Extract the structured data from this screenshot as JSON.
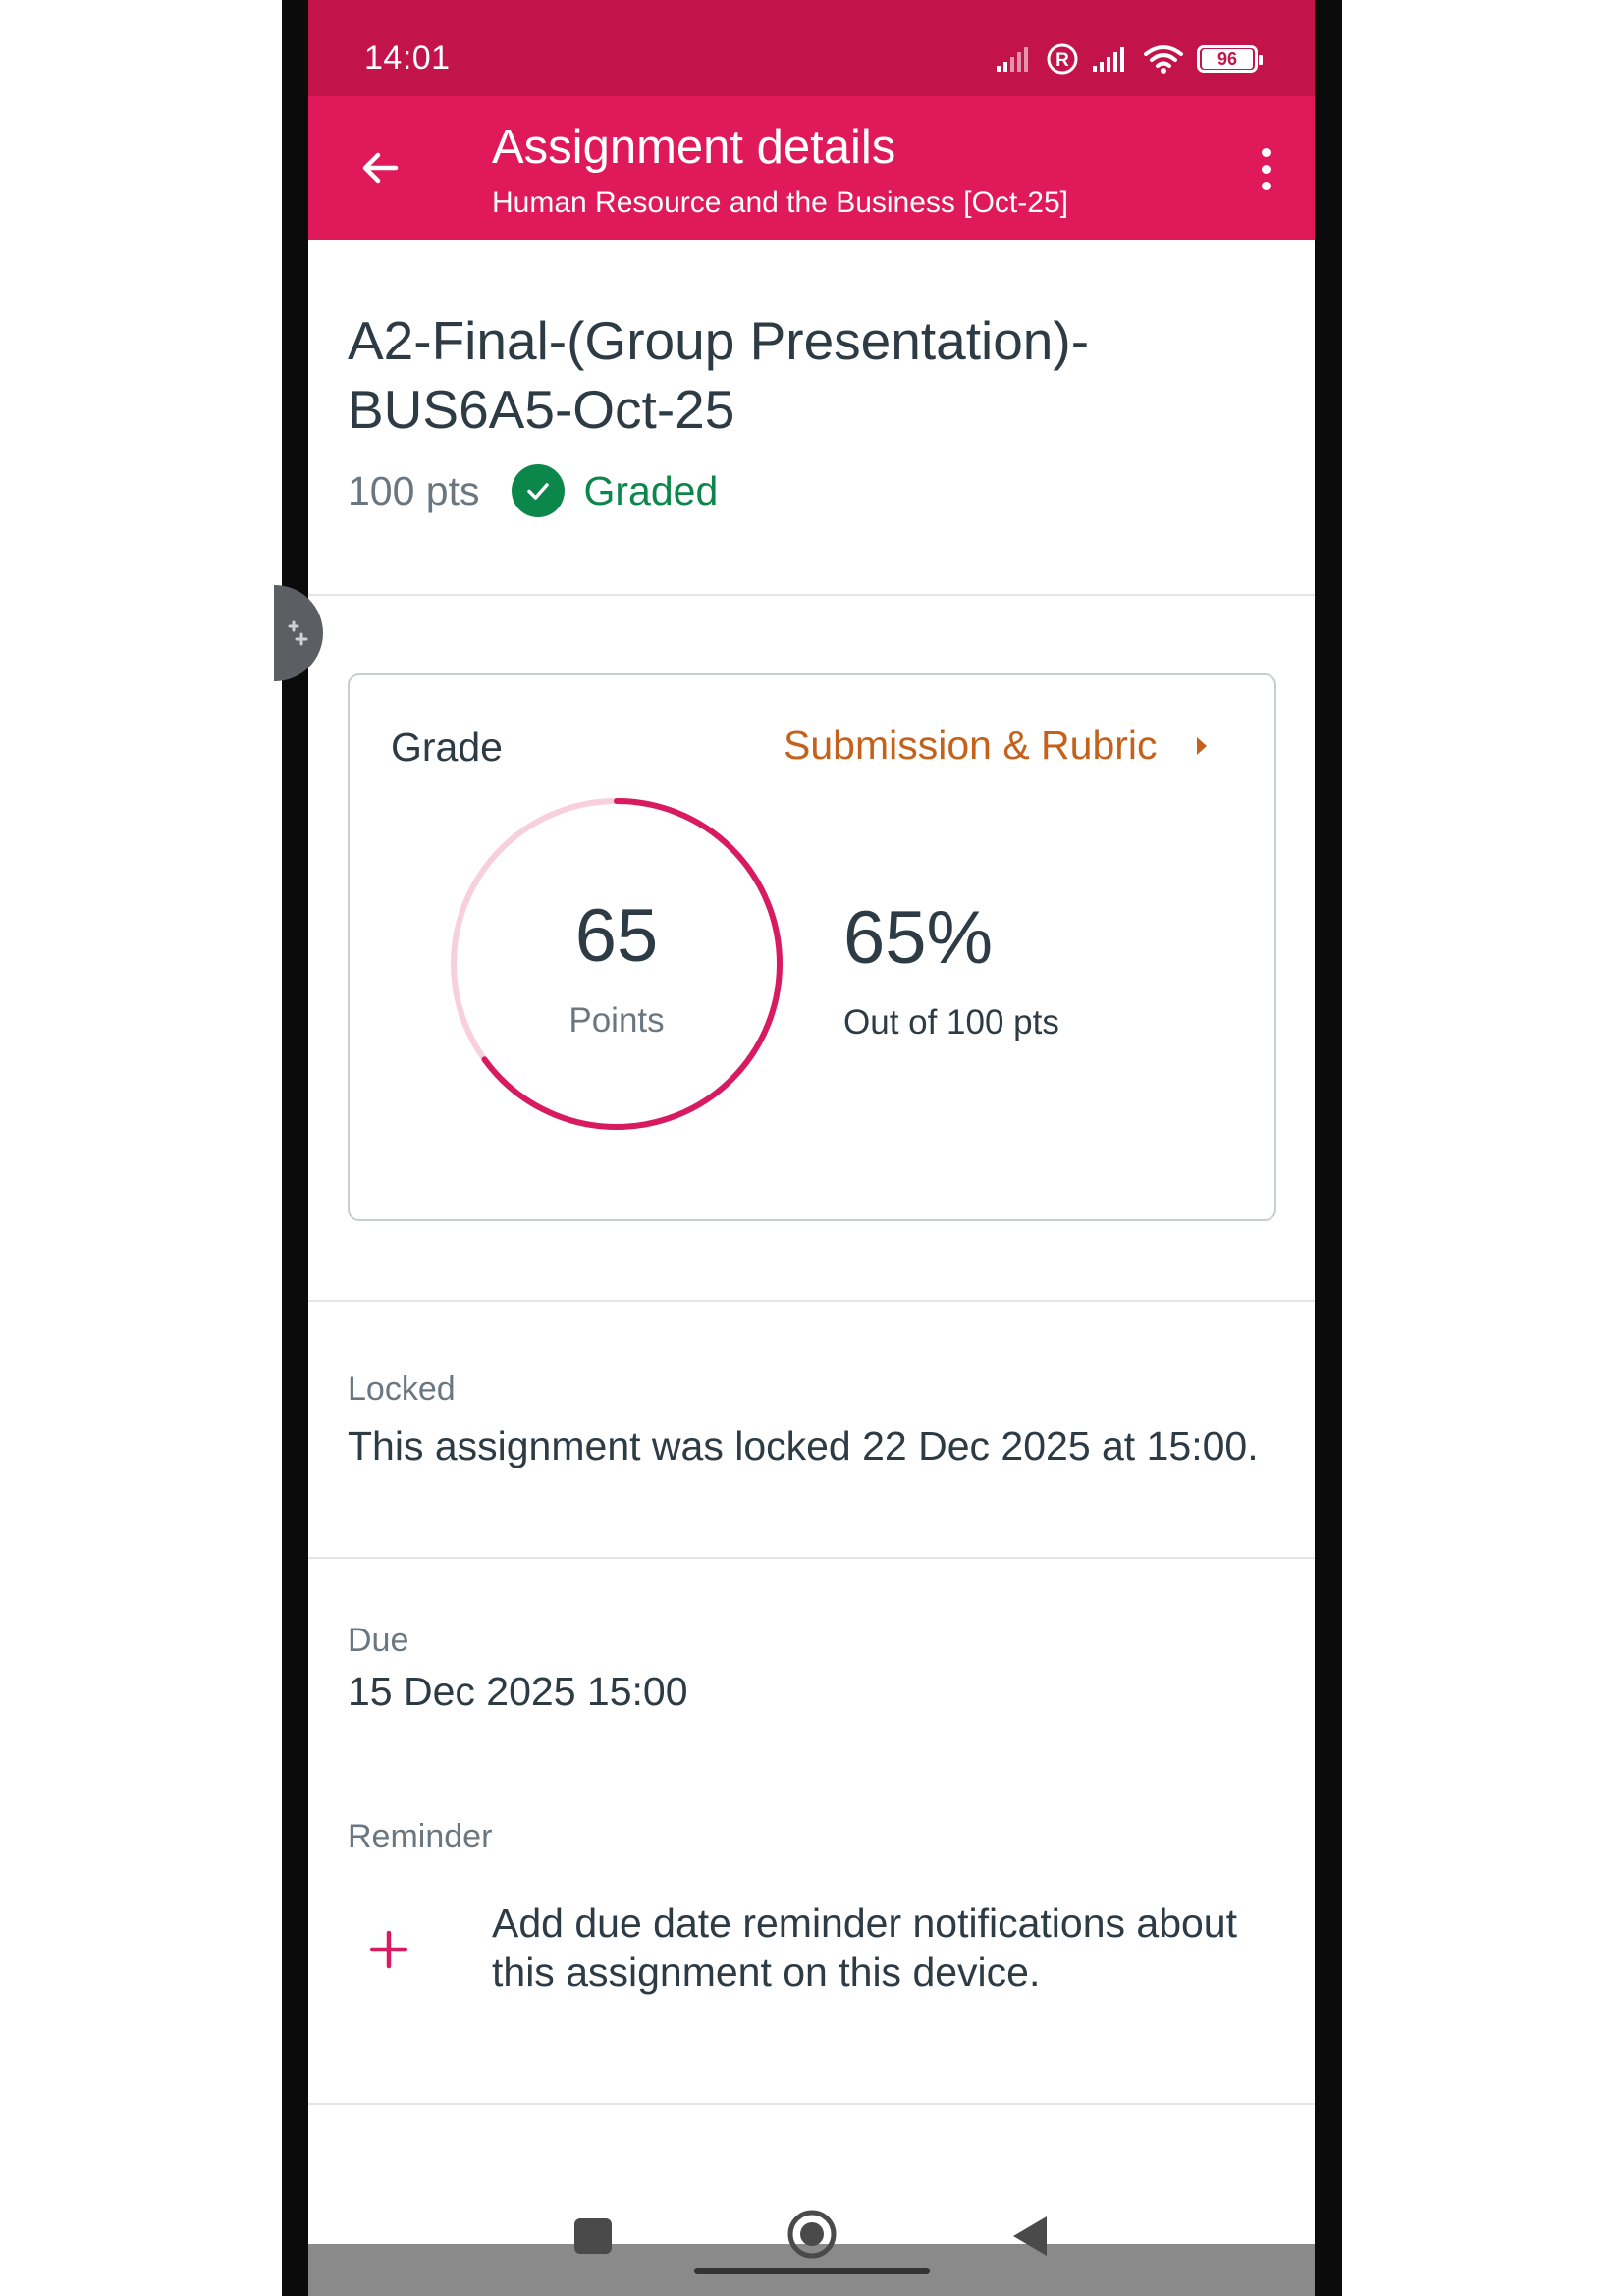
{
  "status_bar": {
    "time": "14:01",
    "battery": "96"
  },
  "toolbar": {
    "title": "Assignment details",
    "subtitle": "Human Resource and the Business [Oct-25]",
    "back_icon": "arrow-left-icon",
    "more_icon": "more-vertical-icon"
  },
  "assignment": {
    "title": "A2-Final-(Group Presentation)-BUS6A5-Oct-25",
    "points": "100 pts",
    "status": "Graded",
    "status_icon": "check-circle-icon"
  },
  "grade": {
    "label": "Grade",
    "link": "Submission & Rubric",
    "score": "65",
    "score_label": "Points",
    "percent": "65%",
    "out_of": "Out of 100 pts",
    "fraction": 0.65
  },
  "locked": {
    "label": "Locked",
    "text": "This assignment was locked 22 Dec 2025 at 15:00."
  },
  "due": {
    "label": "Due",
    "date": "15 Dec 2025 15:00"
  },
  "reminder": {
    "label": "Reminder",
    "text": "Add due date reminder notifications about this assignment on this device.",
    "add_icon": "plus-icon"
  },
  "colors": {
    "status_bar": "#c2134a",
    "toolbar": "#e0195a",
    "accent": "#d81b60",
    "graded": "#0b874b",
    "link": "#c4611a"
  }
}
